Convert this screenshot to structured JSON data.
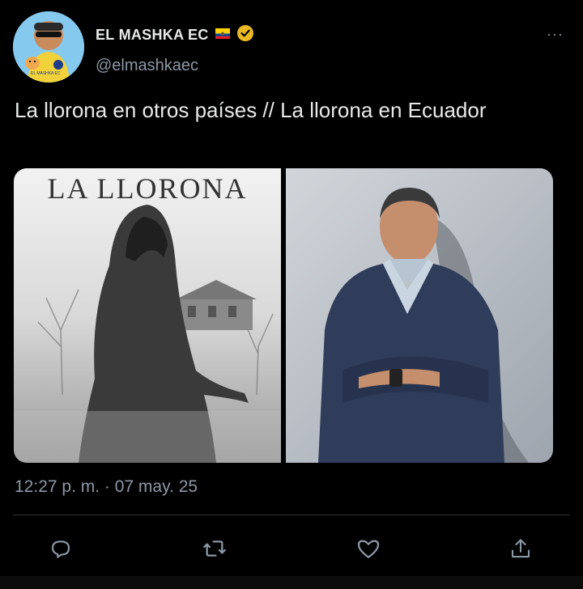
{
  "user": {
    "display_name": "EL MASHKA EC",
    "handle": "@elmashkaec",
    "avatar_text": "EL MASHKA EC",
    "flag": "ecuador-flag",
    "verified_icon": "verified-badge-icon"
  },
  "tweet": {
    "text": "La llorona en otros países // La llorona en Ecuador",
    "timestamp": "12:27 p. m. · 07 may. 25"
  },
  "media": {
    "left_title": "LA LLORONA"
  },
  "actions": {
    "reply": "reply-icon",
    "retweet": "retweet-icon",
    "like": "like-icon",
    "share": "share-icon"
  },
  "more": "···"
}
